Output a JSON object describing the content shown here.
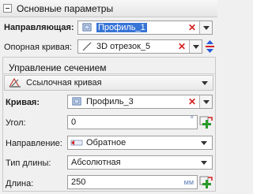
{
  "header": {
    "title": "Основные параметры"
  },
  "guide": {
    "label": "Направляющая:",
    "value": "Профиль_1"
  },
  "base_curve": {
    "label": "Опорная кривая:",
    "value": "3D отрезок_5"
  },
  "section": {
    "title": "Управление сечением",
    "mode_value": "Ссылочная кривая",
    "curve": {
      "label": "Кривая:",
      "value": "Профиль_3"
    },
    "angle": {
      "label": "Угол:",
      "value": "0",
      "unit": "°"
    },
    "direction": {
      "label": "Направление:",
      "value": "Обратное"
    },
    "length_type": {
      "label": "Тип длины:",
      "value": "Абсолютная"
    },
    "length": {
      "label": "Длина:",
      "value": "250",
      "unit": "мм"
    }
  },
  "colors": {
    "accent": "#3875d7",
    "delete": "#d42020",
    "add": "#2a9a2a"
  }
}
